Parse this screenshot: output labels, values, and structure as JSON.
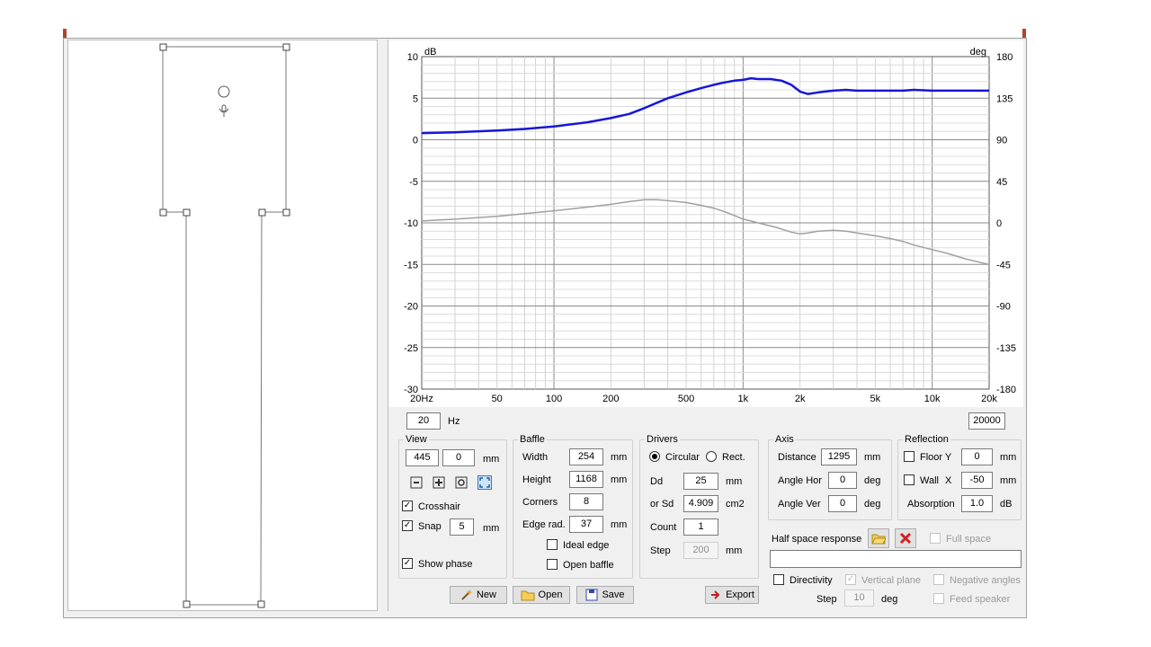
{
  "colors": {
    "response": "#1616d8",
    "phase": "#a0a0a0",
    "accent": "#b0442a",
    "grid": "#b4b4b4"
  },
  "chart_data": {
    "type": "line",
    "xscale": "log",
    "xlim": [
      20,
      20000
    ],
    "ylim": [
      -30,
      10
    ],
    "y2lim": [
      -180,
      180
    ],
    "ylabel": "dB",
    "y2label": "deg",
    "x_ticks": [
      {
        "v": 20,
        "label": "20Hz"
      },
      {
        "v": 50,
        "label": "50"
      },
      {
        "v": 100,
        "label": "100"
      },
      {
        "v": 200,
        "label": "200"
      },
      {
        "v": 500,
        "label": "500"
      },
      {
        "v": 1000,
        "label": "1k"
      },
      {
        "v": 2000,
        "label": "2k"
      },
      {
        "v": 5000,
        "label": "5k"
      },
      {
        "v": 10000,
        "label": "10k"
      },
      {
        "v": 20000,
        "label": "20k"
      }
    ],
    "y_ticks": [
      {
        "v": 10,
        "label": "10"
      },
      {
        "v": 5,
        "label": "5"
      },
      {
        "v": 0,
        "label": "0"
      },
      {
        "v": -5,
        "label": "-5"
      },
      {
        "v": -10,
        "label": "-10"
      },
      {
        "v": -15,
        "label": "-15"
      },
      {
        "v": -20,
        "label": "-20"
      },
      {
        "v": -25,
        "label": "-25"
      },
      {
        "v": -30,
        "label": "-30"
      }
    ],
    "y2_ticks": [
      {
        "v": 180,
        "label": "180"
      },
      {
        "v": 135,
        "label": "135"
      },
      {
        "v": 90,
        "label": "90"
      },
      {
        "v": 45,
        "label": "45"
      },
      {
        "v": 0,
        "label": "0"
      },
      {
        "v": -45,
        "label": "-45"
      },
      {
        "v": -90,
        "label": "-90"
      },
      {
        "v": -135,
        "label": "-135"
      },
      {
        "v": -180,
        "label": "-180"
      }
    ],
    "grid": true,
    "series": [
      {
        "axis": "left",
        "values": [
          [
            20,
            0.8
          ],
          [
            30,
            0.9
          ],
          [
            50,
            1.1
          ],
          [
            70,
            1.3
          ],
          [
            100,
            1.6
          ],
          [
            150,
            2.1
          ],
          [
            200,
            2.6
          ],
          [
            250,
            3.1
          ],
          [
            300,
            3.8
          ],
          [
            400,
            5.0
          ],
          [
            500,
            5.7
          ],
          [
            600,
            6.2
          ],
          [
            700,
            6.6
          ],
          [
            800,
            6.9
          ],
          [
            900,
            7.1
          ],
          [
            1000,
            7.2
          ],
          [
            1100,
            7.4
          ],
          [
            1200,
            7.3
          ],
          [
            1400,
            7.3
          ],
          [
            1600,
            7.1
          ],
          [
            1800,
            6.6
          ],
          [
            2000,
            5.8
          ],
          [
            2200,
            5.5
          ],
          [
            2500,
            5.7
          ],
          [
            3000,
            5.9
          ],
          [
            3500,
            6.0
          ],
          [
            4000,
            5.9
          ],
          [
            5000,
            5.9
          ],
          [
            6000,
            5.9
          ],
          [
            7000,
            5.9
          ],
          [
            8000,
            6.0
          ],
          [
            10000,
            5.9
          ],
          [
            12000,
            5.9
          ],
          [
            15000,
            5.9
          ],
          [
            20000,
            5.9
          ]
        ]
      },
      {
        "axis": "right",
        "values": [
          [
            20,
            2
          ],
          [
            30,
            4
          ],
          [
            50,
            7
          ],
          [
            70,
            10
          ],
          [
            100,
            13
          ],
          [
            150,
            17
          ],
          [
            200,
            20
          ],
          [
            250,
            23
          ],
          [
            300,
            25
          ],
          [
            350,
            25
          ],
          [
            400,
            24
          ],
          [
            500,
            22
          ],
          [
            600,
            19
          ],
          [
            700,
            16
          ],
          [
            800,
            12
          ],
          [
            900,
            8
          ],
          [
            1000,
            4
          ],
          [
            1100,
            2
          ],
          [
            1200,
            0
          ],
          [
            1500,
            -5
          ],
          [
            1800,
            -10
          ],
          [
            2000,
            -12
          ],
          [
            2200,
            -11
          ],
          [
            2500,
            -9
          ],
          [
            3000,
            -8
          ],
          [
            3500,
            -9
          ],
          [
            4000,
            -11
          ],
          [
            5000,
            -14
          ],
          [
            6000,
            -17
          ],
          [
            7000,
            -20
          ],
          [
            8000,
            -24
          ],
          [
            10000,
            -29
          ],
          [
            12000,
            -33
          ],
          [
            15000,
            -39
          ],
          [
            20000,
            -45
          ]
        ]
      }
    ]
  },
  "range": {
    "min": "20",
    "unit": "Hz",
    "max": "20000"
  },
  "view": {
    "title": "View",
    "x": "445",
    "y": "0",
    "unit": "mm",
    "crosshair": "Crosshair",
    "snap": "Snap",
    "snap_value": "5",
    "snap_unit": "mm",
    "show_phase": "Show phase"
  },
  "baffle": {
    "title": "Baffle",
    "width_label": "Width",
    "width": "254",
    "height_label": "Height",
    "height": "1168",
    "corners_label": "Corners",
    "corners": "8",
    "edge_label": "Edge rad.",
    "edge": "37",
    "unit": "mm",
    "ideal_edge": "Ideal edge",
    "open_baffle": "Open baffle"
  },
  "drivers": {
    "title": "Drivers",
    "circular": "Circular",
    "rect": "Rect.",
    "dd_label": "Dd",
    "dd": "25",
    "dd_unit": "mm",
    "sd_label": "or Sd",
    "sd": "4.909",
    "sd_unit": "cm2",
    "count_label": "Count",
    "count": "1",
    "step_label": "Step",
    "step": "200",
    "step_unit": "mm"
  },
  "axis": {
    "title": "Axis",
    "distance_label": "Distance",
    "distance": "1295",
    "distance_unit": "mm",
    "hor_label": "Angle Hor",
    "hor": "0",
    "ver_label": "Angle Ver",
    "ver": "0",
    "deg": "deg"
  },
  "reflection": {
    "title": "Reflection",
    "floor_label": "Floor Y",
    "floor": "0",
    "wall_label": "Wall",
    "wall_axis": "X",
    "wall": "-50",
    "unit": "mm",
    "absorption_label": "Absorption",
    "absorption": "1.0",
    "absorption_unit": "dB"
  },
  "half_space": {
    "label": "Half space response",
    "full_space": "Full space"
  },
  "directivity": {
    "label": "Directivity",
    "vertical_plane": "Vertical plane",
    "negative_angles": "Negative angles",
    "step_label": "Step",
    "step": "10",
    "deg": "deg",
    "feed_speaker": "Feed speaker"
  },
  "buttons": {
    "new": "New",
    "open": "Open",
    "save": "Save",
    "export": "Export"
  }
}
